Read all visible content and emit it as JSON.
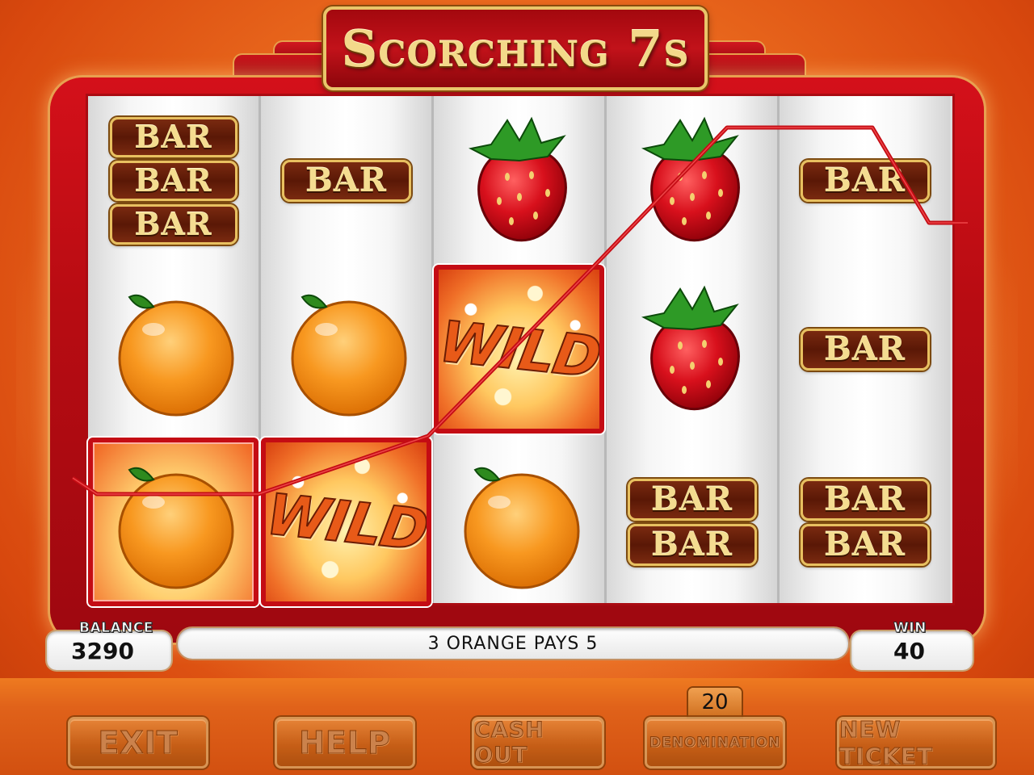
{
  "game": {
    "title": "Scorching 7s"
  },
  "reels": [
    [
      "BAR3",
      "ORANGE",
      "ORANGE"
    ],
    [
      "BAR",
      "ORANGE",
      "WILD"
    ],
    [
      "STRAWBERRY",
      "WILD",
      "ORANGE"
    ],
    [
      "STRAWBERRY",
      "STRAWBERRY",
      "BAR2"
    ],
    [
      "BAR",
      "BAR",
      "BAR2"
    ]
  ],
  "symbols": {
    "bar_label": "BAR",
    "wild_label": "WILD"
  },
  "status": {
    "balance_label": "BALANCE",
    "balance_value": "3290",
    "message": "3 ORANGE PAYS 5",
    "win_label": "WIN",
    "win_value": "40"
  },
  "buttons": {
    "exit": "EXIT",
    "help": "HELP",
    "cash_out": "CASH OUT",
    "denomination": "DENOMINATION",
    "new_ticket": "NEW TICKET"
  },
  "denomination_value": "20",
  "colors": {
    "accent_red": "#c40c14",
    "gold": "#e8c060",
    "background_orange": "#ea6a1e"
  }
}
